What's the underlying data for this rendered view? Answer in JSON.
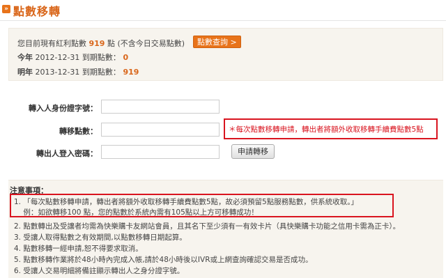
{
  "title_icon": "»",
  "page_title": "點數移轉",
  "points": {
    "line1_prefix": "您目前現有紅利點數",
    "line1_value": "919",
    "line1_suffix": "點 (不含今日交易點數)",
    "query_button": "點數查詢 >",
    "line2_label": "今年",
    "line2_date": "2012-12-31 到期點數：",
    "line2_value": "0",
    "line3_label": "明年",
    "line3_date": "2013-12-31 到期點數：",
    "line3_value": "919"
  },
  "form": {
    "id_label": "轉入人身份證字號：",
    "id_value": "",
    "points_label": "轉移點數：",
    "points_value": "",
    "password_label": "轉出人登入密碼：",
    "password_value": "",
    "notice": "＊每次點數移轉申請，轉出者將額外收取移轉手續費點數5點",
    "apply_button": "申請轉移"
  },
  "notes": {
    "heading": "注意事項：",
    "items": [
      "1. 「每次點數移轉申請，轉出者將額外收取移轉手續費點數5點，故必須預留5點服務點數，供系統收取。」",
      "    例：如欲轉移100 點，您的點數於系統內需有105點以上方可移轉成功！",
      "2. 點數轉出及受讓者均需為快樂購卡友網站會員，且其名下至少須有一有效卡片（具快樂購卡功能之信用卡需為正卡）。",
      "3. 受讓人取得點數之有效期間,以點數移轉日期起算。",
      "4. 點數移轉一經申請,恕不得要求取消。",
      "5. 點數移轉作業將於48小時內完成入帳,請於48小時後以IVR或上網查詢確認交易是否成功。",
      "6. 受讓人交易明細將備註顯示轉出人之身分證字號。"
    ]
  },
  "colors": {
    "accent": "#e8731a",
    "title": "#d9661a",
    "alert": "#d9141f",
    "panel": "#f7f4ee"
  }
}
